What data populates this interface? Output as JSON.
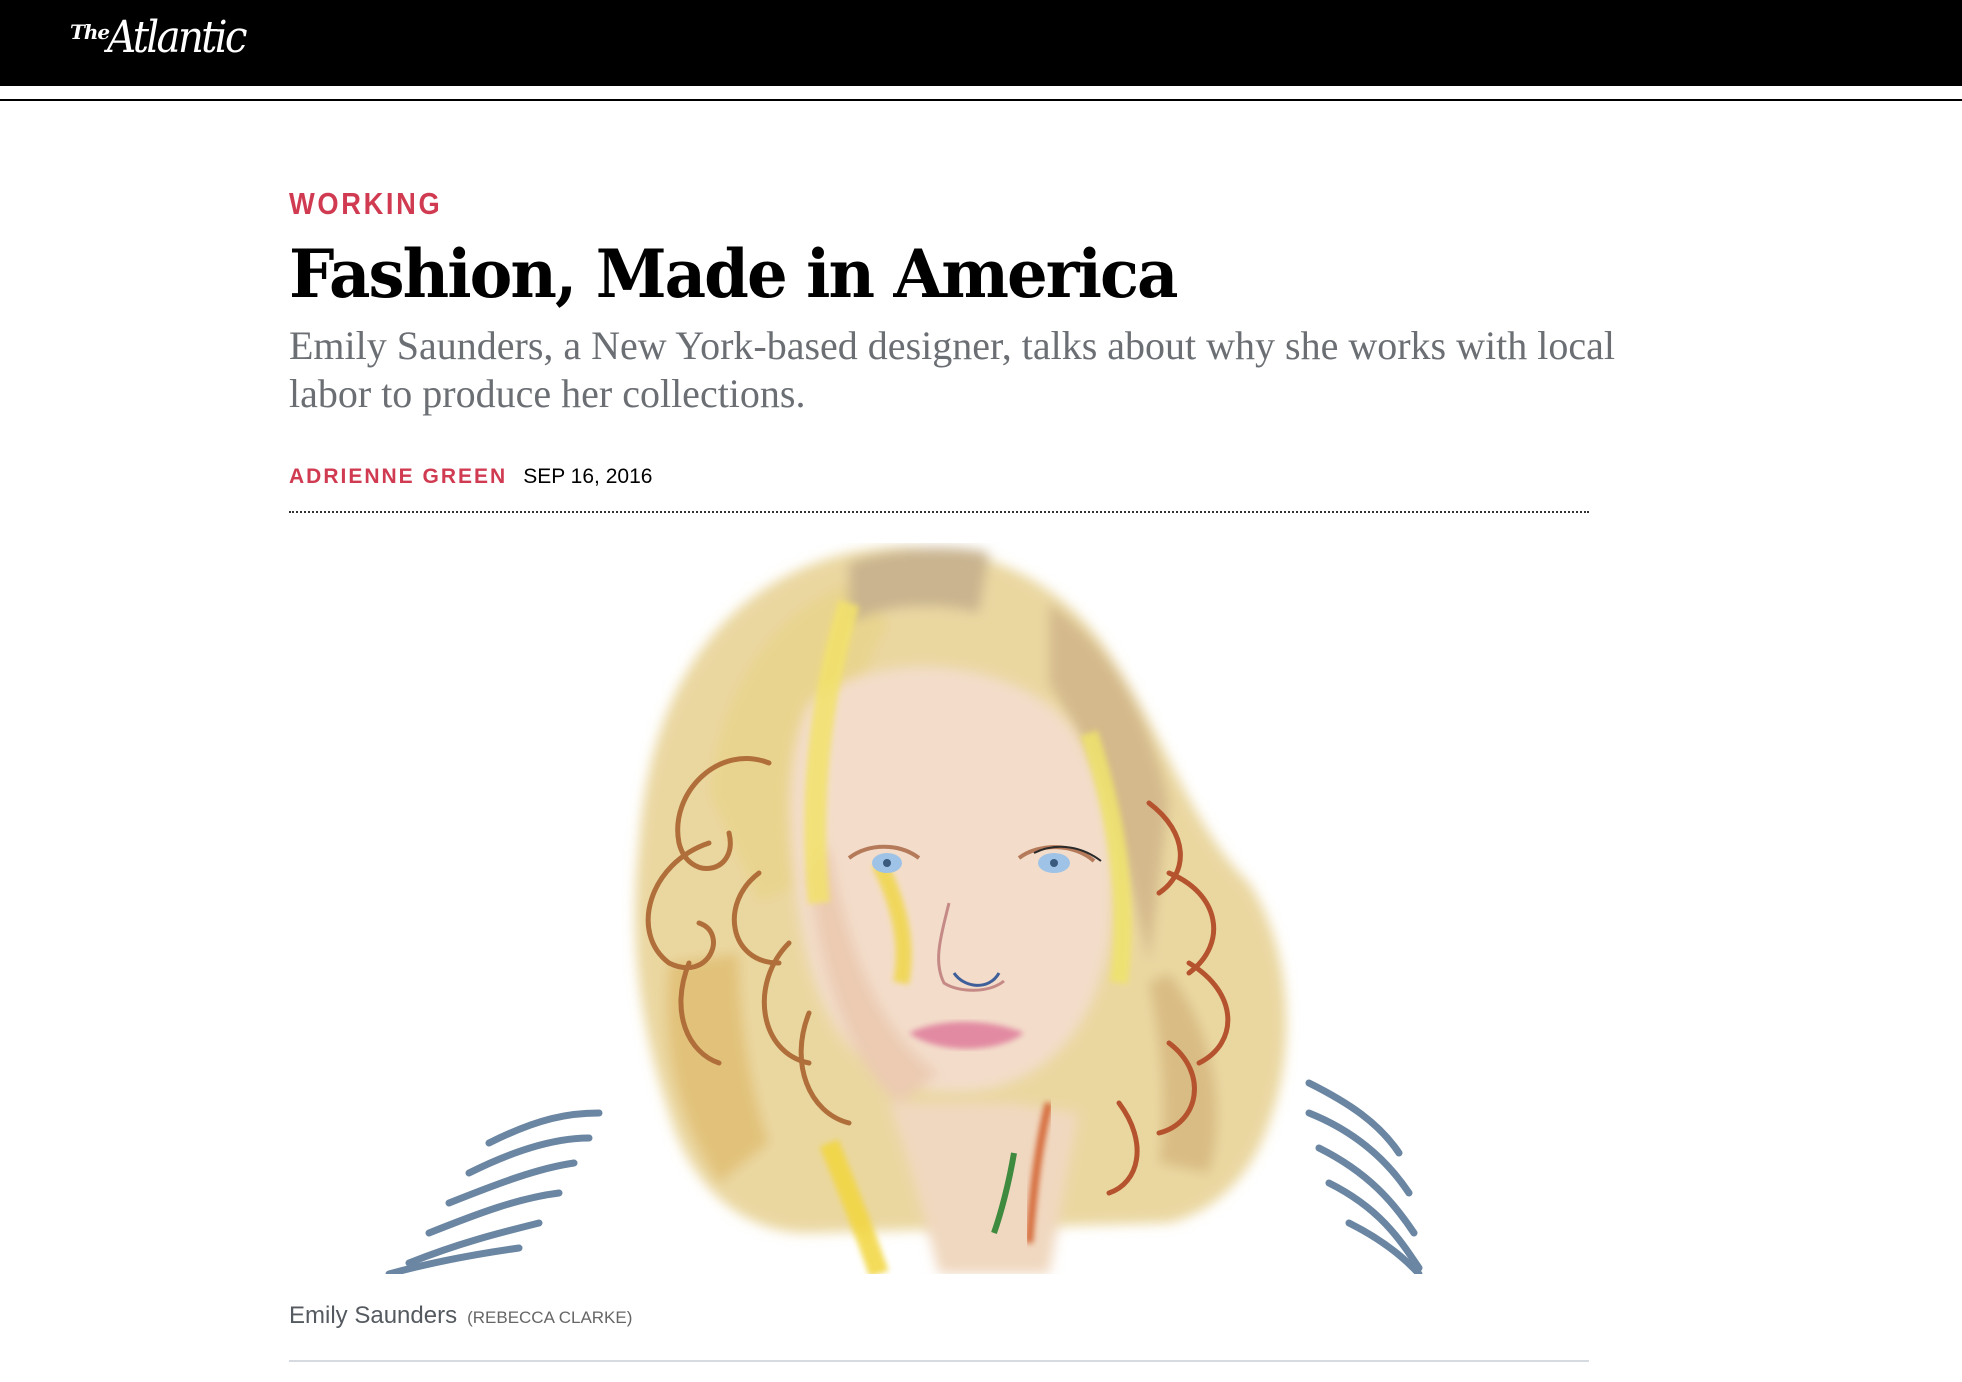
{
  "header": {
    "logo_prefix": "The",
    "logo_name": "Atlantic"
  },
  "article": {
    "section": "WORKING",
    "headline": "Fashion, Made in America",
    "dek": "Emily Saunders, a New York-based designer, talks about why she works with local labor to produce her collections.",
    "author": "ADRIENNE GREEN",
    "date": "SEP 16, 2016",
    "image": {
      "description_icon": "portrait-illustration",
      "caption": "Emily Saunders",
      "credit": "(REBECCA CLARKE)"
    }
  },
  "colors": {
    "accent": "#d03b52",
    "topbar": "#000000",
    "dek": "#6b6f74"
  }
}
